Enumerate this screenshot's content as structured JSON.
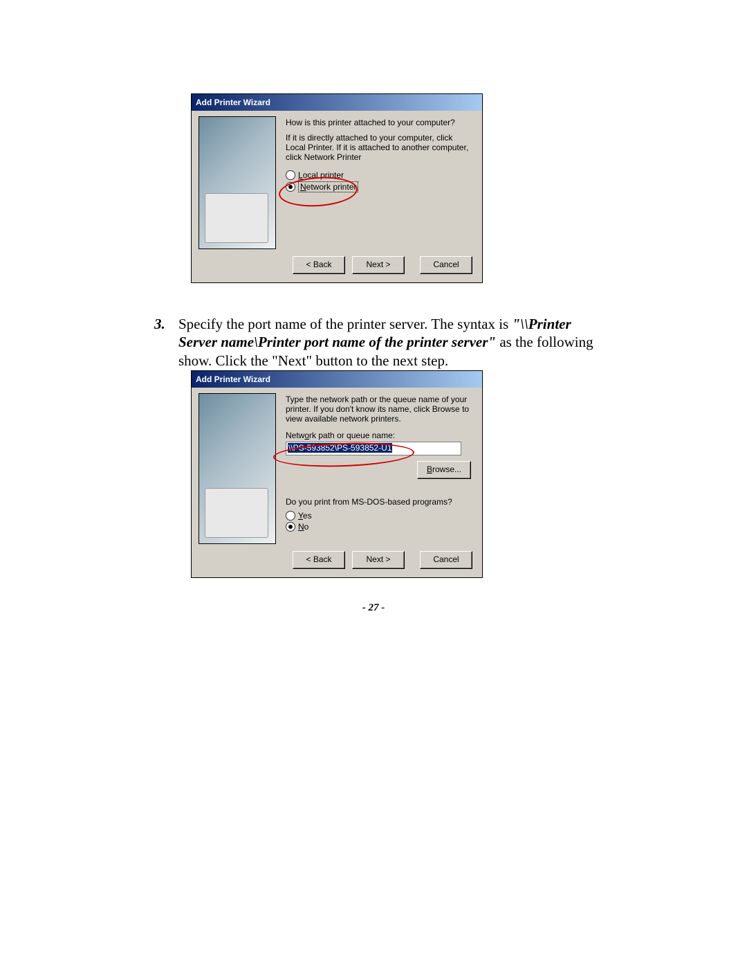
{
  "step": {
    "number": "3.",
    "line1": "Specify the port name of the printer server. The syntax is ",
    "line2_italic": "\"\\\\Printer Server name\\Printer port name of the printer server\"",
    "line3": " as the following show. Click the \"Next\" button to the next step."
  },
  "dialog1": {
    "title": "Add Printer Wizard",
    "question": "How is this printer attached to your computer?",
    "blurb": "If it is directly attached to your computer, click Local Printer. If it is attached to another computer, click Network Printer",
    "opt_local": "Local printer",
    "opt_network": "Network printer",
    "back": "< Back",
    "next": "Next >",
    "cancel": "Cancel"
  },
  "dialog2": {
    "title": "Add Printer Wizard",
    "blurb": "Type the network path or the queue name of your printer. If you don't know its name, click Browse to view available network printers.",
    "path_label": "Network path or queue name:",
    "path_value": "\\\\PS-593852\\PS-593852-U1",
    "browse": "Browse...",
    "dos_q": "Do you print from MS-DOS-based programs?",
    "yes": "Yes",
    "no": "No",
    "back": "< Back",
    "next": "Next >",
    "cancel": "Cancel"
  },
  "page_number": "- 27 -"
}
